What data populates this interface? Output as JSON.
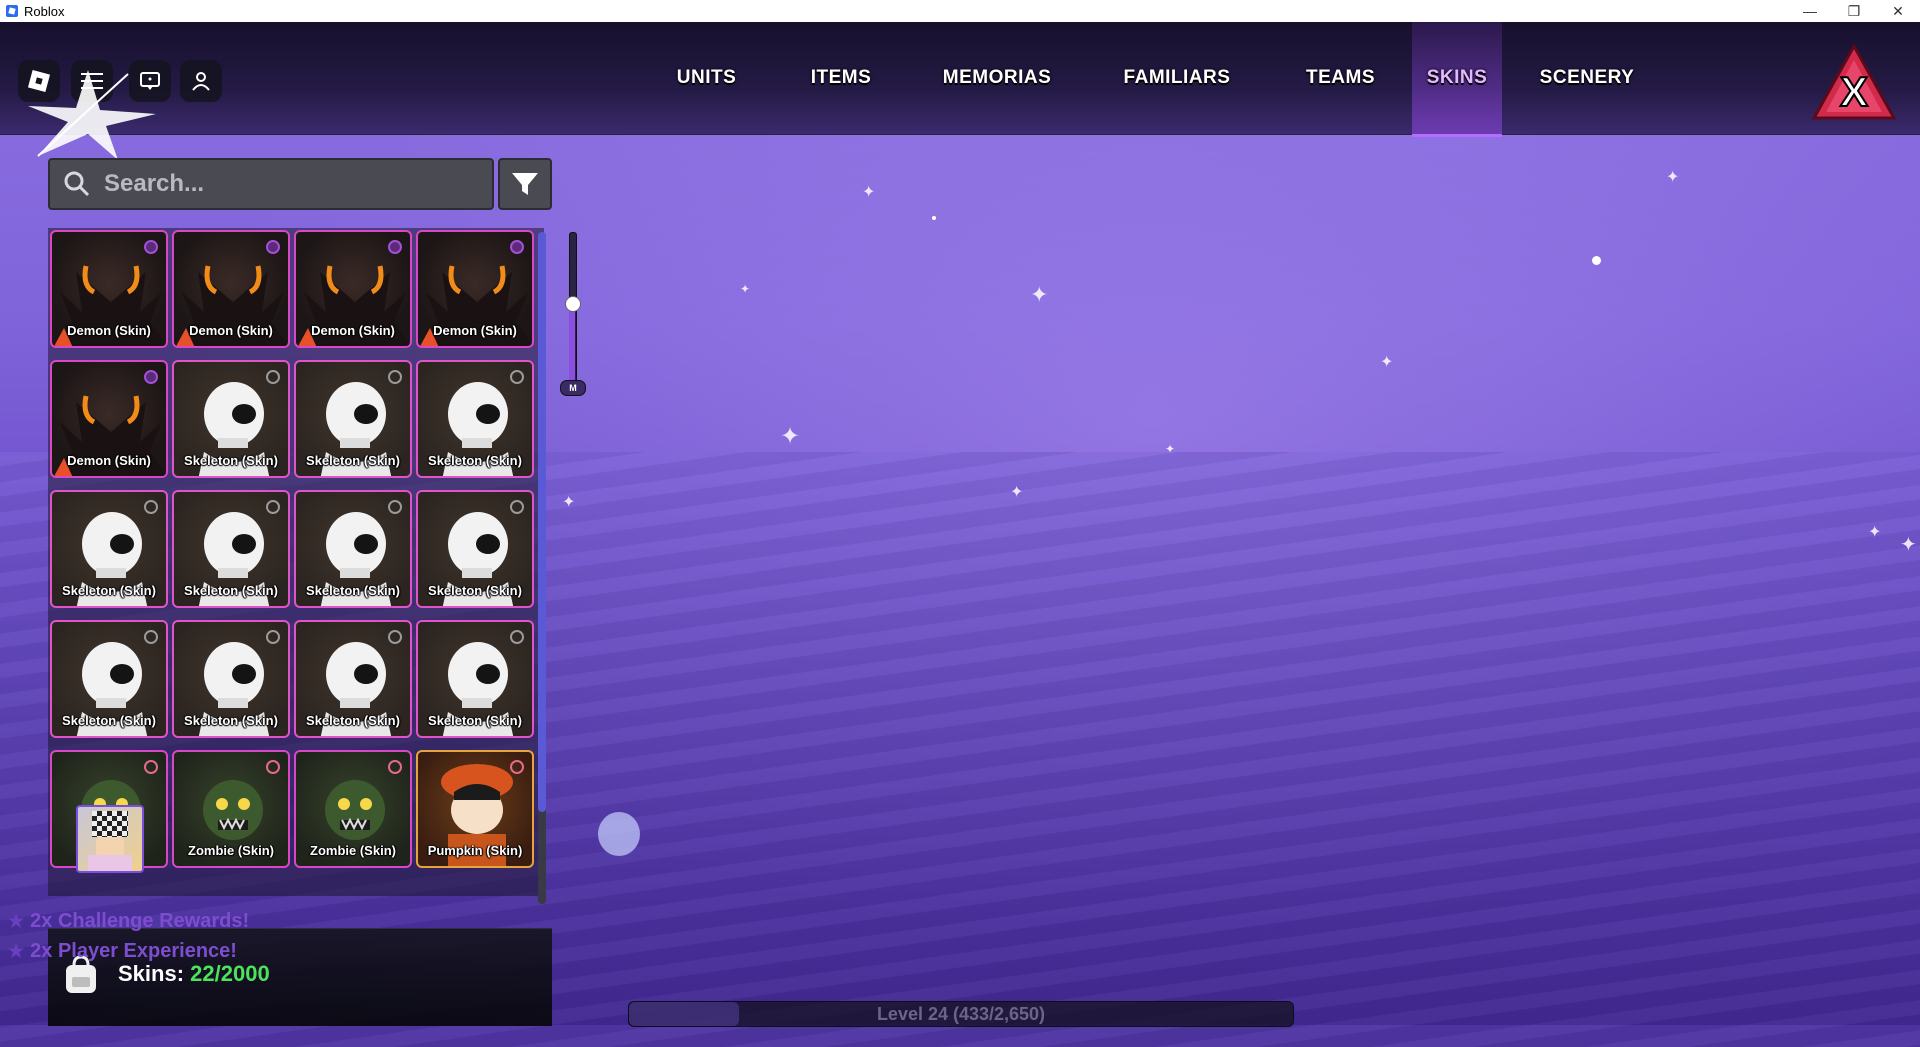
{
  "window": {
    "title": "Roblox",
    "controls": [
      "—",
      "❐",
      "✕"
    ]
  },
  "topbar": {
    "tabs": [
      {
        "label": "UNITS",
        "active": false
      },
      {
        "label": "ITEMS",
        "active": false
      },
      {
        "label": "MEMORIAS",
        "active": false
      },
      {
        "label": "FAMILIARS",
        "active": false
      },
      {
        "label": "TEAMS",
        "active": false
      },
      {
        "label": "SKINS",
        "active": true
      },
      {
        "label": "SCENERY",
        "active": false
      }
    ],
    "left_buttons": [
      "roblox-logo-icon",
      "menu-icon",
      "chat-icon",
      "friends-icon"
    ]
  },
  "search": {
    "placeholder": "Search..."
  },
  "inventory": {
    "items": [
      {
        "label": "Demon (Skin)",
        "kind": "demon"
      },
      {
        "label": "Demon (Skin)",
        "kind": "demon"
      },
      {
        "label": "Demon (Skin)",
        "kind": "demon"
      },
      {
        "label": "Demon (Skin)",
        "kind": "demon"
      },
      {
        "label": "Demon (Skin)",
        "kind": "demon"
      },
      {
        "label": "Skeleton (Skin)",
        "kind": "skeleton"
      },
      {
        "label": "Skeleton (Skin)",
        "kind": "skeleton"
      },
      {
        "label": "Skeleton (Skin)",
        "kind": "skeleton"
      },
      {
        "label": "Skeleton (Skin)",
        "kind": "skeleton"
      },
      {
        "label": "Skeleton (Skin)",
        "kind": "skeleton"
      },
      {
        "label": "Skeleton (Skin)",
        "kind": "skeleton"
      },
      {
        "label": "Skeleton (Skin)",
        "kind": "skeleton"
      },
      {
        "label": "Skeleton (Skin)",
        "kind": "skeleton"
      },
      {
        "label": "Skeleton (Skin)",
        "kind": "skeleton"
      },
      {
        "label": "Skeleton (Skin)",
        "kind": "skeleton"
      },
      {
        "label": "Skeleton (Skin)",
        "kind": "skeleton"
      },
      {
        "label": "Z           n)",
        "kind": "zombie"
      },
      {
        "label": "Zombie (Skin)",
        "kind": "zombie"
      },
      {
        "label": "Zombie (Skin)",
        "kind": "zombie"
      },
      {
        "label": "Pumpkin (Skin)",
        "kind": "pumpkin"
      }
    ]
  },
  "zoom_slider": {
    "label": "M",
    "value": 0.5
  },
  "boosts": [
    "2x Challenge Rewards!",
    "2x Player Experience!"
  ],
  "footer": {
    "skins_label": "Skins:",
    "skins_count": "22/2000"
  },
  "level": {
    "text": "Level 24 (433/2,650)"
  },
  "colors": {
    "active_tab": "#e3b8ff",
    "count_green": "#4be35a",
    "card_border": "#d946c8",
    "pumpkin_border": "#e6a53a"
  }
}
